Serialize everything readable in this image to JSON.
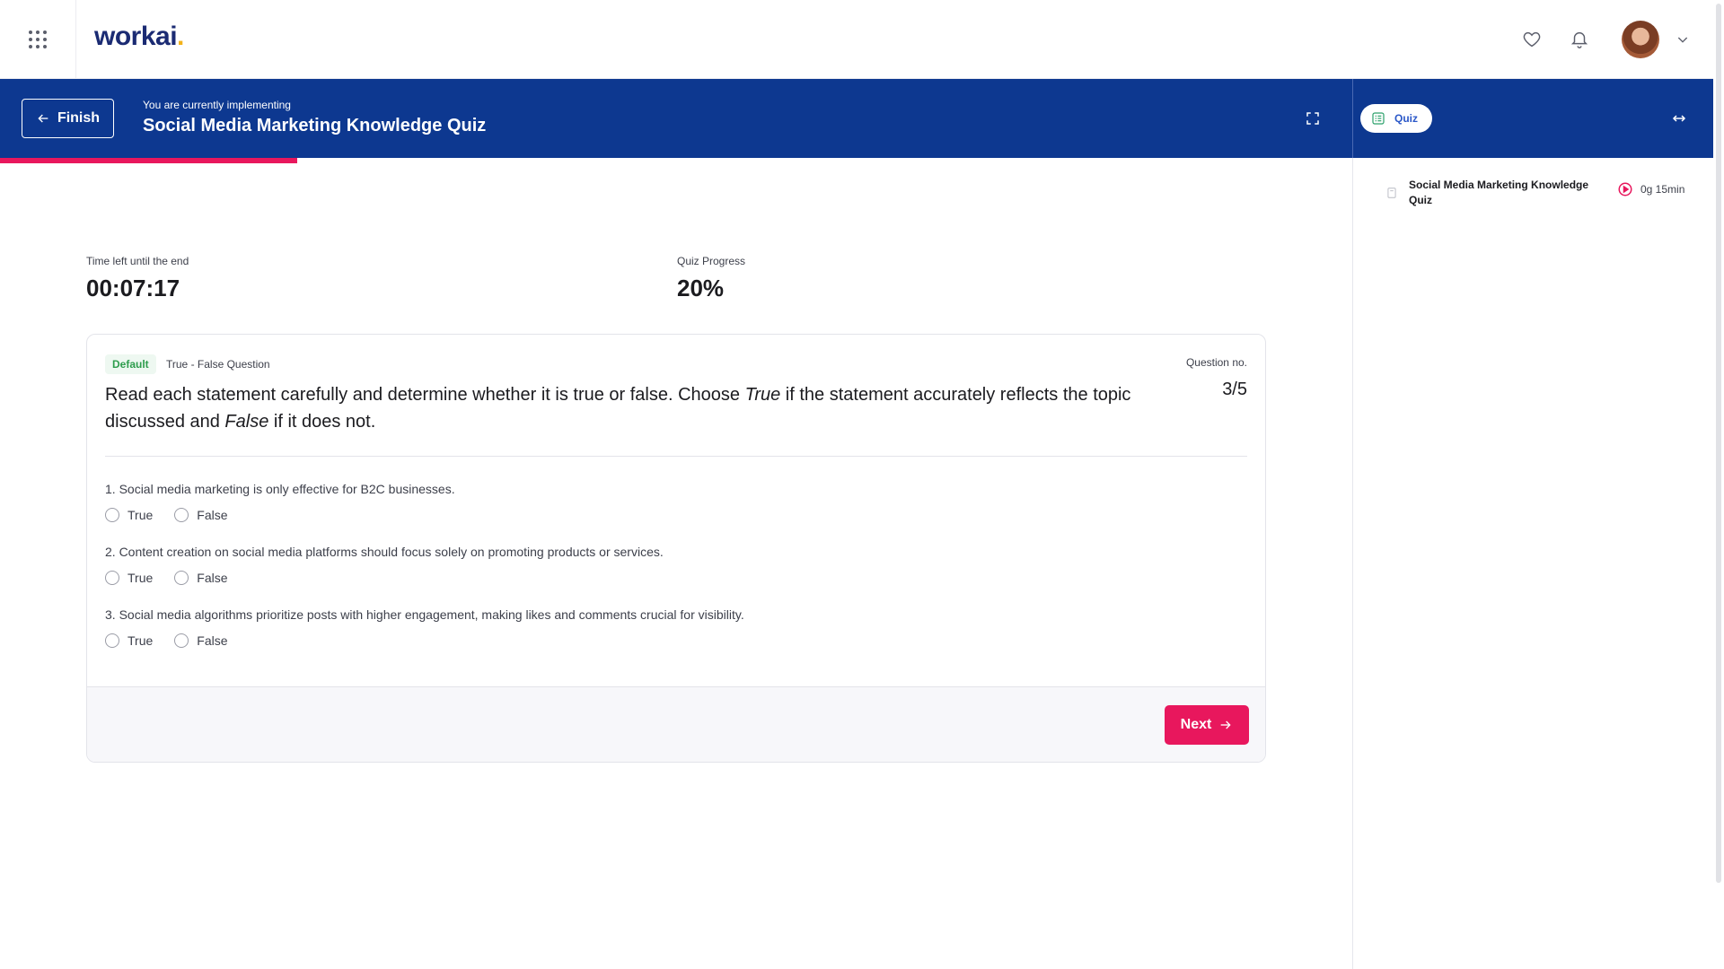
{
  "app": {
    "logo_text": "workai",
    "logo_dot": ".",
    "brand_color": "#1b2b73",
    "accent_color": "#e8175d",
    "header_color": "#0d3890"
  },
  "topbar": {
    "icons": [
      "apps-grid-icon",
      "heart-icon",
      "bell-icon",
      "chevron-down-icon"
    ]
  },
  "header": {
    "finish_label": "Finish",
    "implementing_label": "You are currently implementing",
    "quiz_title": "Social Media Marketing Knowledge Quiz",
    "quiz_pill_label": "Quiz"
  },
  "progress": {
    "fraction": 0.22
  },
  "sidebar": {
    "items": [
      {
        "title": "Social Media Marketing Knowledge Quiz",
        "duration": "0g 15min"
      }
    ]
  },
  "stats": {
    "time_label": "Time left until the end",
    "time_value": "00:07:17",
    "progress_label": "Quiz Progress",
    "progress_value": "20%"
  },
  "question": {
    "tag": "Default",
    "type": "True - False Question",
    "number_label": "Question no.",
    "number_value": "3/5",
    "text_part1": "Read each statement carefully and determine whether it is true or false. Choose ",
    "text_true": "True",
    "text_part2": " if the statement accurately reflects the topic discussed and ",
    "text_false": "False",
    "text_part3": " if it does not.",
    "statements": [
      "1. Social media marketing is only effective for B2C businesses.",
      "2. Content creation on social media platforms should focus solely on promoting products or services.",
      "3. Social media algorithms prioritize posts with higher engagement, making likes and comments crucial for visibility."
    ],
    "option_true": "True",
    "option_false": "False"
  },
  "footer": {
    "next_label": "Next"
  }
}
